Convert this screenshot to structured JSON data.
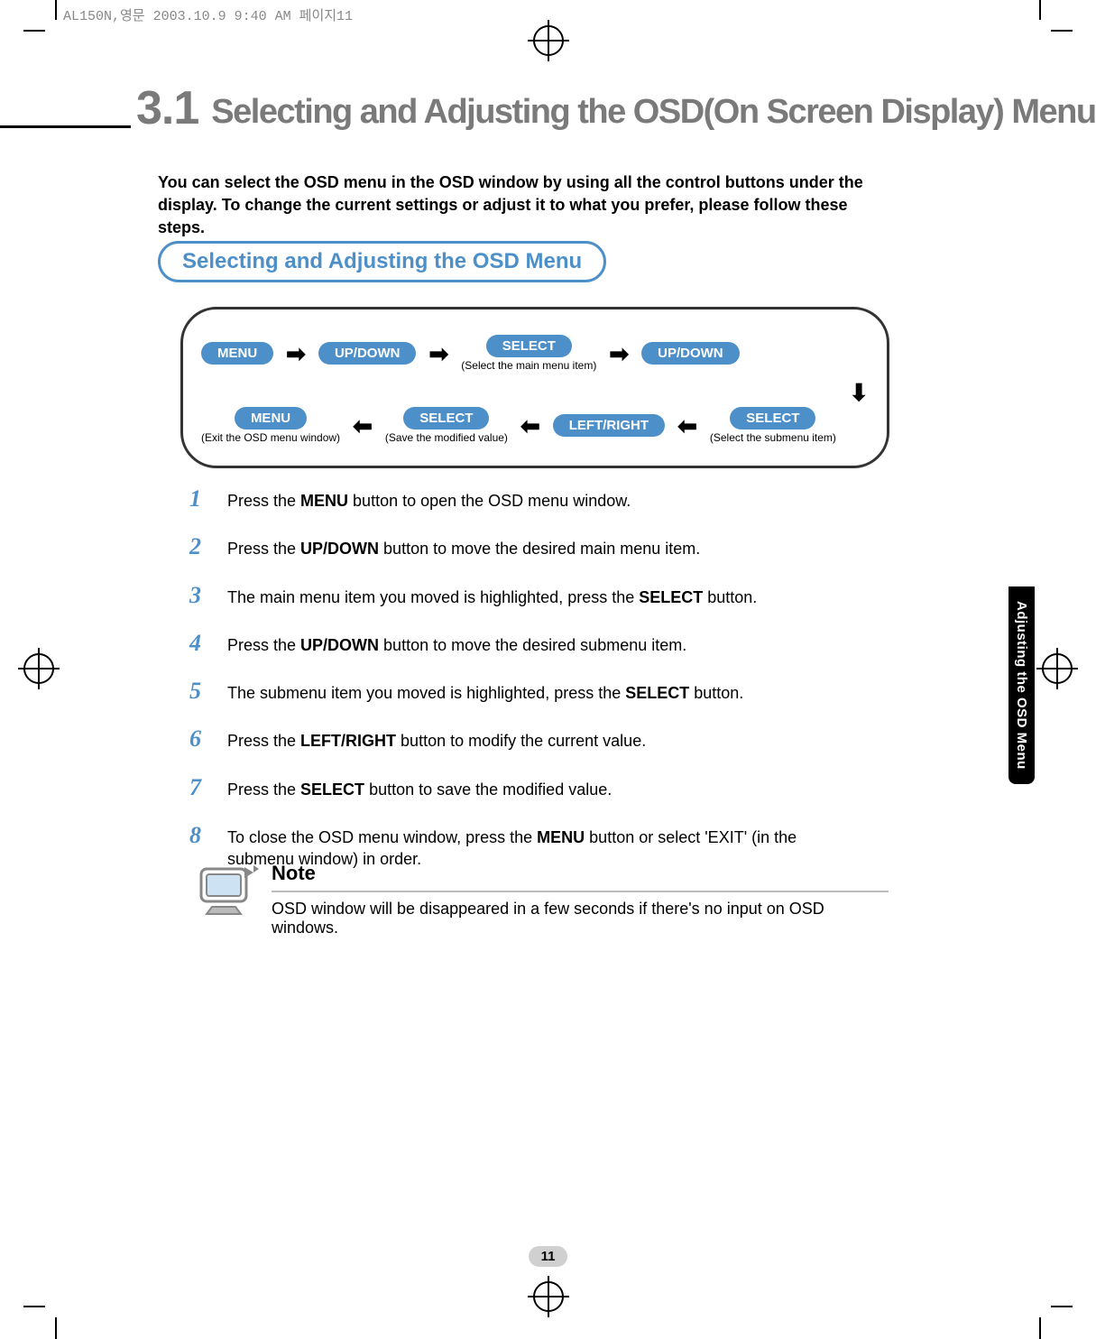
{
  "print_header": "AL150N,영문  2003.10.9 9:40 AM  페이지11",
  "section_number": "3.1",
  "section_title": "Selecting and Adjusting the OSD(On Screen Display) Menu",
  "intro": "You can select the OSD menu in the OSD window by using all the control buttons under the display. To change the current settings or adjust it to what you prefer, please follow these steps.",
  "capsule_heading": "Selecting and Adjusting the OSD Menu",
  "flow": {
    "top": [
      {
        "label": "MENU",
        "caption": ""
      },
      {
        "label": "UP/DOWN",
        "caption": ""
      },
      {
        "label": "SELECT",
        "caption": "(Select the main menu item)"
      },
      {
        "label": "UP/DOWN",
        "caption": ""
      }
    ],
    "bottom": [
      {
        "label": "MENU",
        "caption": "(Exit the OSD menu window)"
      },
      {
        "label": "SELECT",
        "caption": "(Save the modified value)"
      },
      {
        "label": "LEFT/RIGHT",
        "caption": ""
      },
      {
        "label": "SELECT",
        "caption": "(Select the submenu item)"
      }
    ]
  },
  "steps": [
    {
      "num": "1",
      "html": "Press the <b>MENU</b> button to open the OSD menu window."
    },
    {
      "num": "2",
      "html": "Press the <b>UP/DOWN</b> button to move the desired main menu item."
    },
    {
      "num": "3",
      "html": "The main menu item you moved is highlighted, press the <b>SELECT</b> button."
    },
    {
      "num": "4",
      "html": "Press the <b>UP/DOWN</b> button to move the desired submenu item."
    },
    {
      "num": "5",
      "html": "The submenu item you moved is highlighted, press the <b>SELECT</b> button."
    },
    {
      "num": "6",
      "html": "Press the <b>LEFT/RIGHT</b> button to modify the current value."
    },
    {
      "num": "7",
      "html": "Press the <b>SELECT</b> button to save the modified value."
    },
    {
      "num": "8",
      "html": "To close the OSD menu window, press the <b>MENU</b> button or select 'EXIT' (in the submenu window) in order."
    }
  ],
  "note": {
    "title": "Note",
    "text": "OSD window will be disappeared in a few seconds if there's no input on OSD windows."
  },
  "side_tab": "Adjusting the OSD Menu",
  "page_number": "11"
}
